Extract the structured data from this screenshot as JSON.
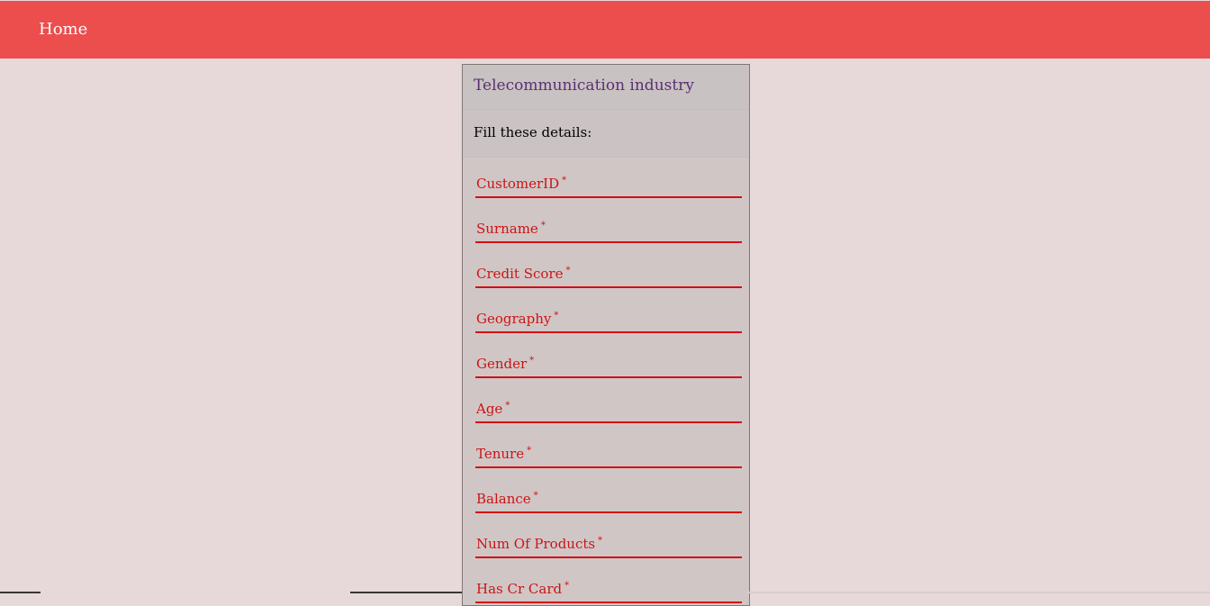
{
  "navbar": {
    "home_label": "Home",
    "color": "#ec4d4d"
  },
  "form": {
    "title": "Telecommunication industry",
    "subtitle": "Fill these details:",
    "required_marker": "*",
    "fields": [
      {
        "label": "CustomerID"
      },
      {
        "label": "Surname"
      },
      {
        "label": "Credit Score"
      },
      {
        "label": "Geography"
      },
      {
        "label": "Gender"
      },
      {
        "label": "Age"
      },
      {
        "label": "Tenure"
      },
      {
        "label": "Balance"
      },
      {
        "label": "Num Of Products"
      },
      {
        "label": "Has Cr Card"
      }
    ]
  }
}
